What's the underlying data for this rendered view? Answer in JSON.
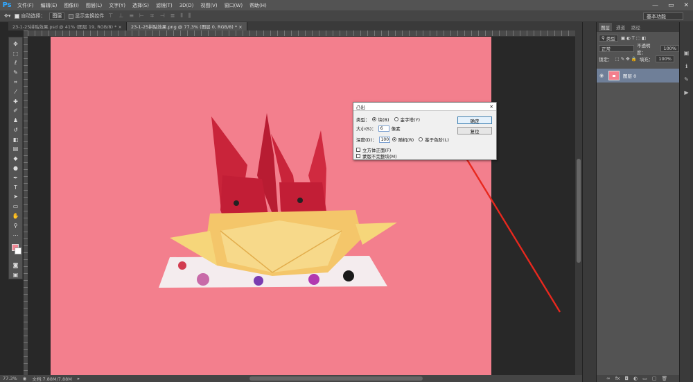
{
  "app": {
    "logo": "Ps"
  },
  "menu": [
    "文件(F)",
    "编辑(E)",
    "图像(I)",
    "图层(L)",
    "文字(Y)",
    "选择(S)",
    "滤镜(T)",
    "3D(D)",
    "视图(V)",
    "窗口(W)",
    "帮助(H)"
  ],
  "window_controls": {
    "minimize": "—",
    "maximize": "▭",
    "close": "✕"
  },
  "options": {
    "auto_select_label": "自动选择：",
    "auto_select_value": "图层",
    "show_transform_label": "显示变换控件",
    "workspace": "基本功能"
  },
  "tabs": [
    {
      "label": "23-1-25拼贴效果.psd @ 41% (图层 19, RGB/8) *  ×"
    },
    {
      "label": "23-1-25拼贴效果.png @ 77.3% (图层 0, RGB/8) *  ×"
    }
  ],
  "status": {
    "zoom": "77.3%",
    "doc": "文档:7.88M/7.88M"
  },
  "layers_panel": {
    "tabs": [
      "图层",
      "通道",
      "路径"
    ],
    "filter_label": "类型",
    "blend_mode": "正常",
    "opacity_label": "不透明度：",
    "opacity_value": "100%",
    "lock_label": "锁定：",
    "fill_label": "填充：",
    "fill_value": "100%",
    "layer_name": "图层 0"
  },
  "dialog": {
    "title": "凸出",
    "type_label": "类型：",
    "type_opt1": "块(B)",
    "type_opt2": "金字塔(Y)",
    "size_label": "大小(S)：",
    "size_value": "6",
    "size_unit": "像素",
    "depth_label": "深度(D)：",
    "depth_value": "100",
    "depth_opt1": "随机(R)",
    "depth_opt2": "基于色阶(L)",
    "check1": "立方体正面(F)",
    "check2": "蒙版不完整块(M)",
    "ok": "确定",
    "reset": "复位"
  },
  "colors": {
    "canvas": "#f37f8d",
    "accent_arrow": "#e8281e",
    "foreground_swatch": "#f38694"
  }
}
